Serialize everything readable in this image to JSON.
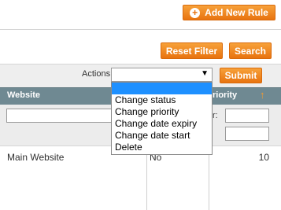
{
  "header": {
    "add_new_rule_label": "Add New Rule"
  },
  "filters": {
    "reset_label": "Reset Filter",
    "search_label": "Search"
  },
  "actions": {
    "label": "Actions",
    "selected": "",
    "options": [
      "",
      "Change status",
      "Change priority",
      "Change date expiry",
      "Change date start",
      "Delete"
    ],
    "submit_label": "Submit"
  },
  "grid": {
    "columns": {
      "website": "Website",
      "priority": "riority"
    },
    "filter_from_label": "r:",
    "rows": [
      {
        "website": "Main Website",
        "status": "No",
        "priority": "10"
      }
    ]
  },
  "colors": {
    "accent": "#e8730f",
    "header_bg": "#6f8992",
    "highlight": "#1e90ff"
  }
}
